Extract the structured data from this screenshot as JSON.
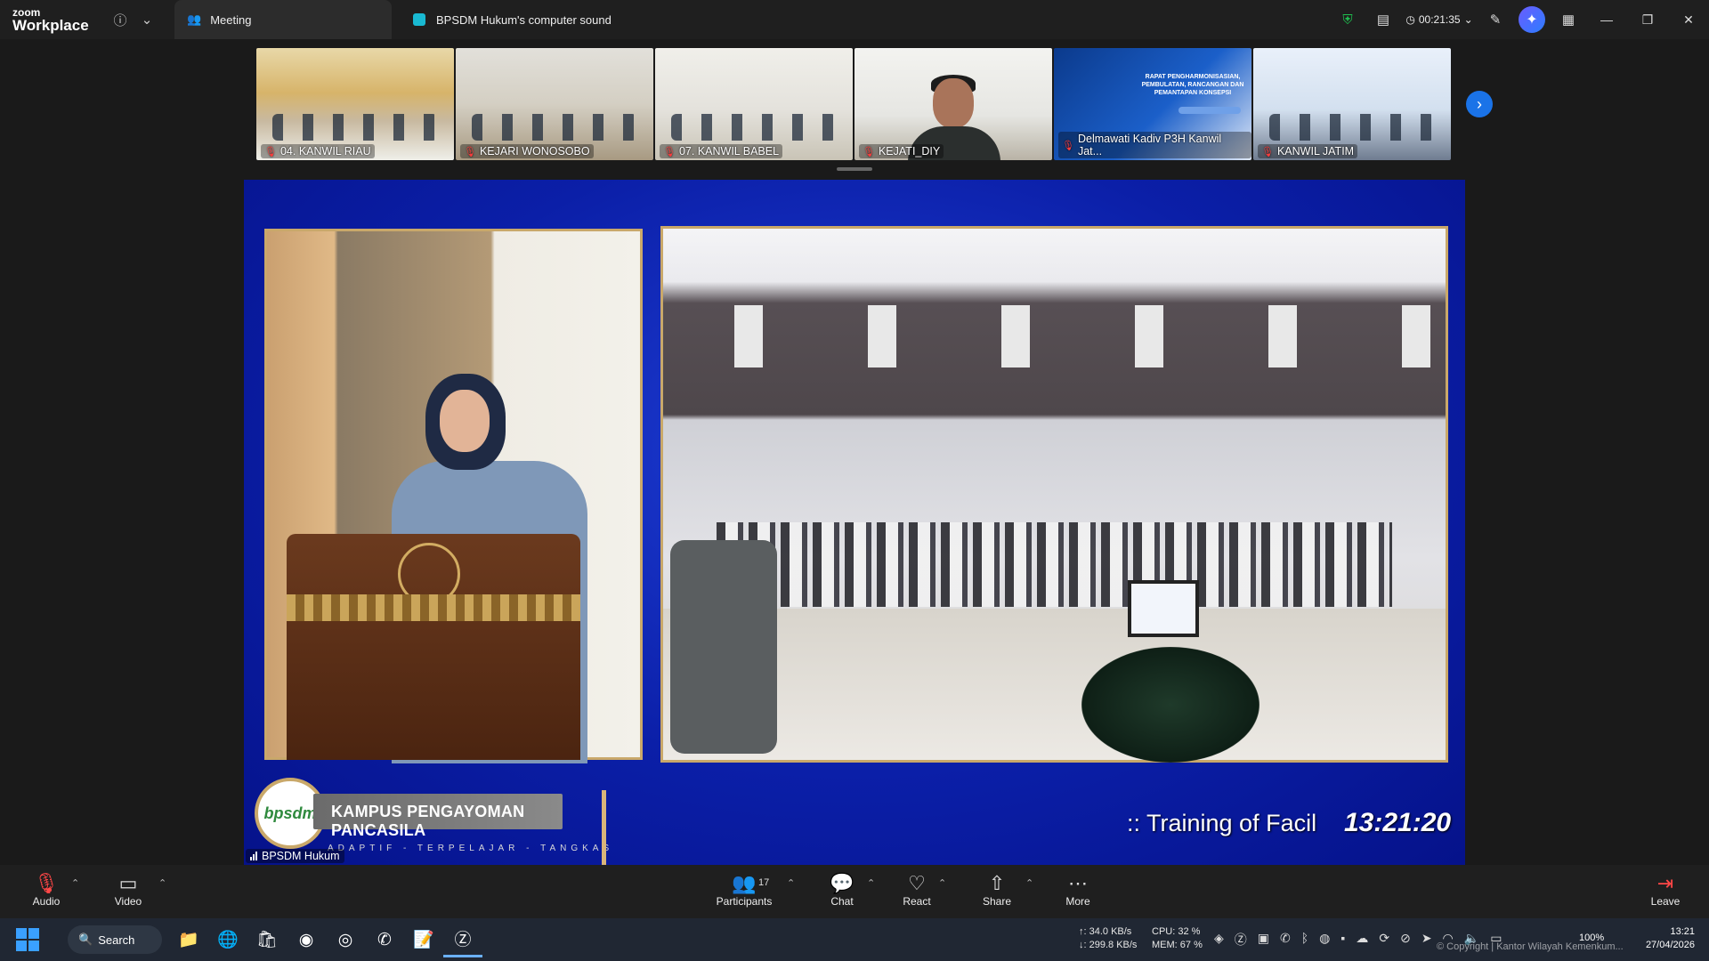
{
  "app": {
    "brand_top": "zoom",
    "brand_bottom": "Workplace"
  },
  "tabs": [
    {
      "label": "Meeting"
    },
    {
      "label": "BPSDM Hukum's computer sound"
    }
  ],
  "header": {
    "timer": "00:21:35"
  },
  "gallery": [
    {
      "name": "04. KANWIL RIAU",
      "muted": true
    },
    {
      "name": "KEJARI WONOSOBO",
      "muted": true
    },
    {
      "name": "07. KANWIL BABEL",
      "muted": true
    },
    {
      "name": "KEJATI_DIY",
      "muted": true
    },
    {
      "name": "Delmawati Kadiv P3H Kanwil Jat...",
      "muted": true
    },
    {
      "name": "KANWIL JATIM",
      "muted": true
    }
  ],
  "slide_tile": {
    "text": "RAPAT PENGHARMONISASIAN, PEMBULATAN, RANCANGAN DAN PEMANTAPAN KONSEPSI"
  },
  "stage": {
    "logo_text": "bpsdm",
    "banner_title": "KAMPUS PENGAYOMAN PANCASILA",
    "banner_tagline": "ADAPTIF - TERPELAJAR - TANGKAS",
    "ticker": ":: Training of Facil",
    "clock": "13:21:20",
    "speaker": "BPSDM Hukum"
  },
  "controls": {
    "audio": "Audio",
    "video": "Video",
    "participants": "Participants",
    "participants_count": "17",
    "chat": "Chat",
    "react": "React",
    "share": "Share",
    "more": "More",
    "leave": "Leave"
  },
  "taskbar": {
    "search": "Search",
    "net_up": "↑: 34.0 KB/s",
    "net_down": "↓: 299.8 KB/s",
    "cpu": "CPU: 32 %",
    "mem": "MEM: 67 %",
    "battery": "100%",
    "time": "13:21",
    "date": "27/04/2026",
    "copyright": "© Copyright | Kantor Wilayah Kemenkum..."
  },
  "colors": {
    "accent": "#1a73e8",
    "leave": "#ff4747",
    "stage_blue": "#0b1fa8",
    "gold": "#c9a86a"
  }
}
